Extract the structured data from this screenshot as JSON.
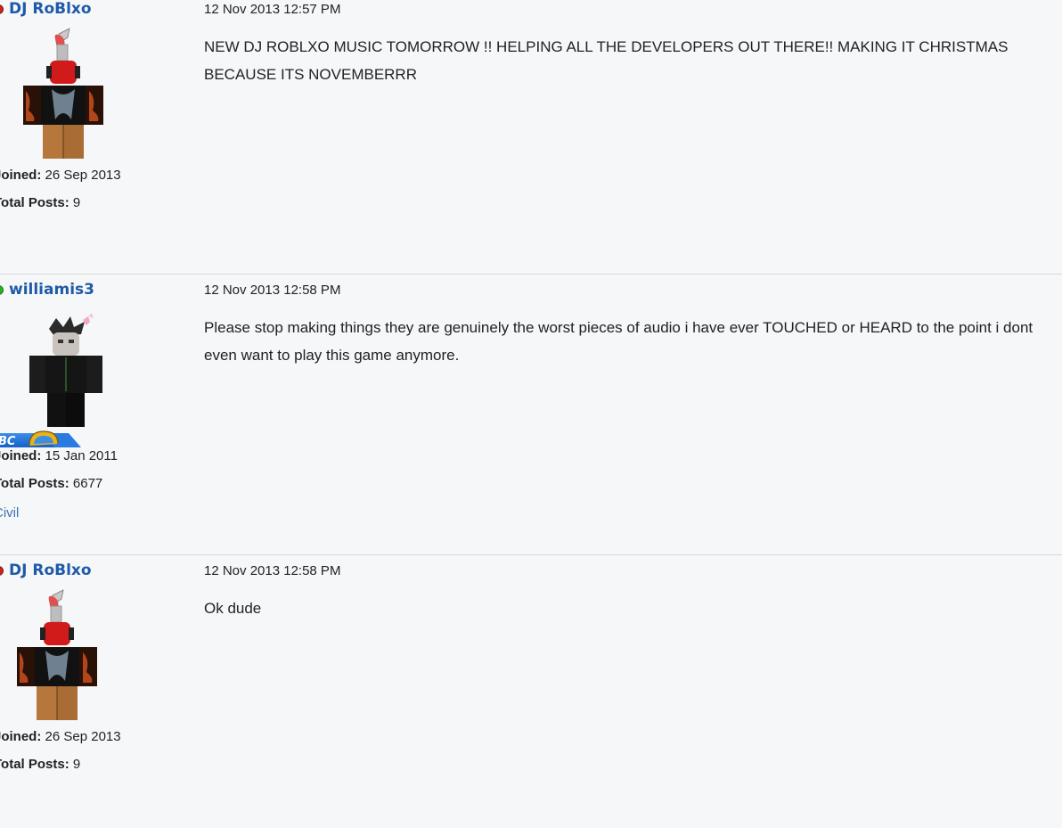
{
  "posts": [
    {
      "username": "DJ RoBlxo",
      "status_color": "#cc2222",
      "avatar": "red-headed-avatar",
      "timestamp": "12 Nov 2013 12:57 PM",
      "body": "NEW DJ ROBLXO MUSIC TOMORROW !! HELPING ALL THE DEVELOPERS OUT THERE!! MAKING IT CHRISTMAS BECAUSE ITS NOVEMBERRR",
      "joined_label": "Joined:",
      "joined_value": "26 Sep 2013",
      "posts_label": "Total Posts:",
      "posts_value": "9"
    },
    {
      "username": "williamis3",
      "status_color": "#22b722",
      "avatar": "black-suit-avatar",
      "badge_text": "BC",
      "timestamp": "12 Nov 2013 12:58 PM",
      "body": "Please stop making things they are genuinely the worst pieces of audio i have ever TOUCHED or HEARD to the point i dont even want to play this game anymore.",
      "joined_label": "Joined:",
      "joined_value": "15 Jan 2011",
      "posts_label": "Total Posts:",
      "posts_value": "6677",
      "rank": "Civil"
    },
    {
      "username": "DJ RoBlxo",
      "status_color": "#cc2222",
      "avatar": "red-headed-avatar",
      "timestamp": "12 Nov 2013 12:58 PM",
      "body": "Ok dude",
      "joined_label": "Joined:",
      "joined_value": "26 Sep 2013",
      "posts_label": "Total Posts:",
      "posts_value": "9"
    }
  ]
}
